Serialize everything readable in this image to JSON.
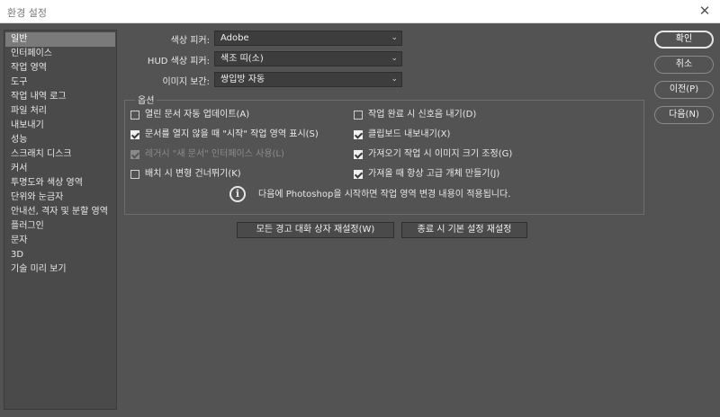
{
  "window": {
    "title": "환경 설정",
    "close_glyph": "✕"
  },
  "sidebar": {
    "items": [
      {
        "label": "일반",
        "selected": true
      },
      {
        "label": "인터페이스"
      },
      {
        "label": "작업 영역"
      },
      {
        "label": "도구"
      },
      {
        "label": "작업 내역 로그"
      },
      {
        "label": "파일 처리"
      },
      {
        "label": "내보내기"
      },
      {
        "label": "성능"
      },
      {
        "label": "스크래치 디스크"
      },
      {
        "label": "커서"
      },
      {
        "label": "투명도와 색상 영역"
      },
      {
        "label": "단위와 눈금자"
      },
      {
        "label": "안내선, 격자 및 분할 영역"
      },
      {
        "label": "플러그인"
      },
      {
        "label": "문자"
      },
      {
        "label": "3D"
      },
      {
        "label": "기술 미리 보기"
      }
    ]
  },
  "fields": {
    "color_picker": {
      "label": "색상 피커:",
      "value": "Adobe"
    },
    "hud_color_picker": {
      "label": "HUD 색상 피커:",
      "value": "색조 띠(소)"
    },
    "image_interpolation": {
      "label": "이미지 보간:",
      "value": "쌍입방 자동"
    }
  },
  "options": {
    "title": "옵션",
    "left": [
      {
        "label": "열린 문서 자동 업데이트(A)",
        "checked": false
      },
      {
        "label": "문서를 열지 않을 때 \"시작\" 작업 영역 표시(S)",
        "checked": true
      },
      {
        "label": "레거시 \"새 문서\" 인터페이스 사용(L)",
        "checked": true,
        "disabled": true
      },
      {
        "label": "배치 시 변형 건너뛰기(K)",
        "checked": false
      }
    ],
    "right": [
      {
        "label": "작업 완료 시 신호음 내기(D)",
        "checked": false
      },
      {
        "label": "클립보드 내보내기(X)",
        "checked": true
      },
      {
        "label": "가져오기 작업 시 이미지 크기 조정(G)",
        "checked": true
      },
      {
        "label": "가져올 때 항상 고급 개체 만들기(J)",
        "checked": true
      }
    ],
    "info_glyph": "i",
    "info_text": "다음에 Photoshop을 시작하면 작업 영역 변경 내용이 적용됩니다."
  },
  "bottom_buttons": {
    "reset_warnings": "모든 경고 대화 상자 재설정(W)",
    "reset_on_quit": "종료 시 기본 설정 재설정"
  },
  "side_buttons": {
    "ok": "확인",
    "cancel": "취소",
    "prev": "이전(P)",
    "next": "다음(N)"
  },
  "icons": {
    "dropdown": "⌄"
  },
  "colors": {
    "dialog_bg": "#535353",
    "sidebar_bg": "#4a4a4a",
    "selected_item": "#7a7a7a",
    "field_bg": "#3d3d3d",
    "titlebar_bg": "#ffffff"
  }
}
